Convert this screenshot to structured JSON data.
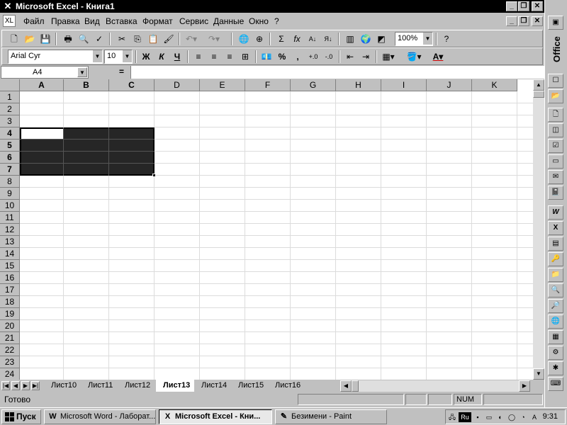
{
  "window": {
    "title": "Microsoft Excel - Книга1"
  },
  "menu": {
    "items": [
      "Файл",
      "Правка",
      "Вид",
      "Вставка",
      "Формат",
      "Сервис",
      "Данные",
      "Окно",
      "?"
    ]
  },
  "standard_toolbar": {
    "zoom": "100%"
  },
  "format_toolbar": {
    "font_name": "Arial Cyr",
    "font_size": "10",
    "bold": "Ж",
    "italic": "К",
    "underline": "Ч",
    "percent": "%",
    "comma": ",",
    "sum": "Σ",
    "fx": "fx"
  },
  "formula_bar": {
    "name_box": "A4",
    "equals": "=",
    "content": ""
  },
  "grid": {
    "columns": [
      "A",
      "B",
      "C",
      "D",
      "E",
      "F",
      "G",
      "H",
      "I",
      "J",
      "K"
    ],
    "rows": [
      "1",
      "2",
      "3",
      "4",
      "5",
      "6",
      "7",
      "8",
      "9",
      "10",
      "11",
      "12",
      "13",
      "14",
      "15",
      "16",
      "17",
      "18",
      "19",
      "20",
      "21",
      "22",
      "23",
      "24"
    ],
    "active_cell": "A4",
    "selection": "A4:C7"
  },
  "sheet_tabs": {
    "tabs": [
      "Лист10",
      "Лист11",
      "Лист12",
      "Лист13",
      "Лист14",
      "Лист15",
      "Лист16"
    ],
    "active": "Лист13"
  },
  "status_bar": {
    "text": "Готово",
    "num": "NUM"
  },
  "office_bar": {
    "label": "Office"
  },
  "taskbar": {
    "start": "Пуск",
    "buttons": [
      {
        "label": "Microsoft Word - Лаборат...",
        "icon": "W"
      },
      {
        "label": "Microsoft Excel - Кни...",
        "icon": "X"
      },
      {
        "label": "Безимени - Paint",
        "icon": "✎"
      }
    ],
    "active_button": 1,
    "tray_lang": "Ru",
    "clock": "9:31"
  },
  "colors": {
    "titlebar": "#000000",
    "selection": "#262626",
    "face": "#c0c0c0"
  }
}
